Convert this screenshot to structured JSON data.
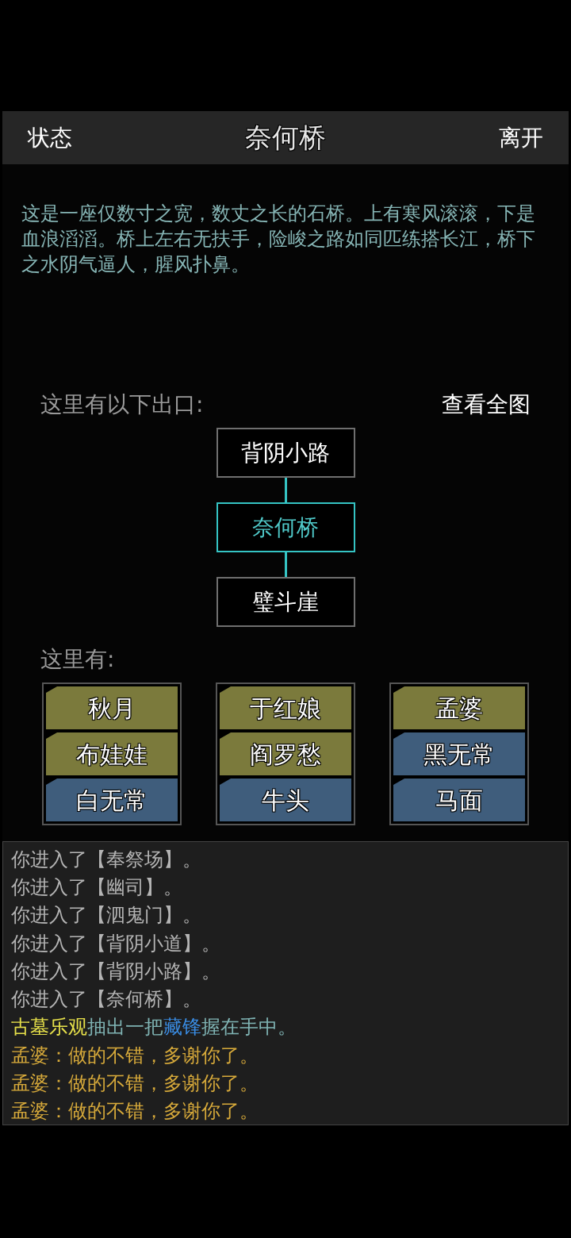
{
  "header": {
    "left_button": "状态",
    "title": "奈何桥",
    "right_button": "离开"
  },
  "description": "这是一座仅数寸之宽，数丈之长的石桥。上有寒风滚滚，下是血浪滔滔。桥上左右无扶手，险峻之路如同匹练搭长江，桥下之水阴气逼人，腥风扑鼻。",
  "exits": {
    "label": "这里有以下出口:",
    "map_link": "查看全图",
    "nodes": [
      {
        "name": "背阴小路",
        "selected": false
      },
      {
        "name": "奈何桥",
        "selected": true
      },
      {
        "name": "璧斗崖",
        "selected": false
      }
    ]
  },
  "npcs": {
    "label": "这里有:",
    "columns": [
      [
        {
          "name": "秋月",
          "color": "#7b7a3c"
        },
        {
          "name": "布娃娃",
          "color": "#7b7a3c"
        },
        {
          "name": "白无常",
          "color": "#3f5d7c"
        }
      ],
      [
        {
          "name": "于红娘",
          "color": "#7b7a3c"
        },
        {
          "name": "阎罗愁",
          "color": "#7b7a3c"
        },
        {
          "name": "牛头",
          "color": "#3f5d7c"
        }
      ],
      [
        {
          "name": "孟婆",
          "color": "#7b7a3c"
        },
        {
          "name": "黑无常",
          "color": "#3f5d7c"
        },
        {
          "name": "马面",
          "color": "#3f5d7c"
        }
      ]
    ]
  },
  "log": [
    [
      {
        "text": "你进入了【奉祭场】。",
        "color": "#b4b4b4"
      }
    ],
    [
      {
        "text": "你进入了【幽司】。",
        "color": "#b4b4b4"
      }
    ],
    [
      {
        "text": "你进入了【泗鬼门】。",
        "color": "#b4b4b4"
      }
    ],
    [
      {
        "text": "你进入了【背阴小道】。",
        "color": "#b4b4b4"
      }
    ],
    [
      {
        "text": "你进入了【背阴小路】。",
        "color": "#b4b4b4"
      }
    ],
    [
      {
        "text": "你进入了【奈何桥】。",
        "color": "#b4b4b4"
      }
    ],
    [
      {
        "text": "古墓乐观",
        "color": "#e6e04a"
      },
      {
        "text": "抽出一把",
        "color": "#7fb3b3"
      },
      {
        "text": "藏锋",
        "color": "#3a8ee6"
      },
      {
        "text": "握在手中。",
        "color": "#7fb3b3"
      }
    ],
    [
      {
        "text": "孟婆：做的不错，多谢你了。",
        "color": "#d6a93a"
      }
    ],
    [
      {
        "text": "孟婆：做的不错，多谢你了。",
        "color": "#d6a93a"
      }
    ],
    [
      {
        "text": "孟婆：做的不错，多谢你了。",
        "color": "#d6a93a"
      }
    ]
  ]
}
